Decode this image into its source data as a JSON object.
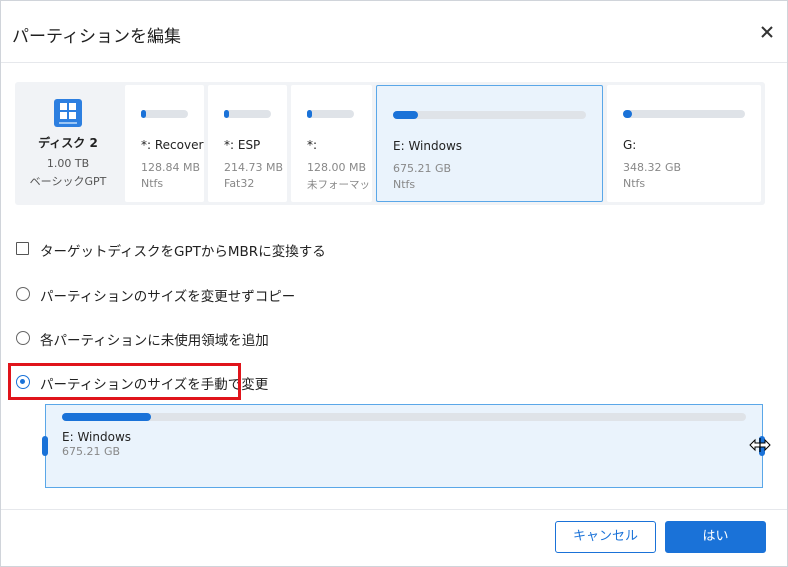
{
  "dialog": {
    "title": "パーティションを編集",
    "close_icon": "close-icon"
  },
  "disk": {
    "icon": "windows-disk-icon",
    "name": "ディスク 2",
    "size": "1.00 TB",
    "type": "ベーシックGPT"
  },
  "partitions": [
    {
      "label": "*: Recovery",
      "capacity": "128.84 MB",
      "fs": "Ntfs",
      "used_fraction": 0.1,
      "selected": false
    },
    {
      "label": "*: ESP",
      "capacity": "214.73 MB",
      "fs": "Fat32",
      "used_fraction": 0.1,
      "selected": false
    },
    {
      "label": "*:",
      "capacity": "128.00 MB",
      "fs": "未フォーマット",
      "used_fraction": 0.1,
      "selected": false
    },
    {
      "label": "E: Windows",
      "capacity": "675.21 GB",
      "fs": "Ntfs",
      "used_fraction": 0.13,
      "selected": true
    },
    {
      "label": "G:",
      "capacity": "348.32 GB",
      "fs": "Ntfs",
      "used_fraction": 0.07,
      "selected": false
    }
  ],
  "options": {
    "convert_mbr": {
      "label": "ターゲットディスクをGPTからMBRに変換する",
      "checked": false
    },
    "copy_no_resize": {
      "label": "パーティションのサイズを変更せずコピー",
      "selected": false
    },
    "add_unused": {
      "label": "各パーティションに未使用領域を追加",
      "selected": false
    },
    "manual_resize": {
      "label": "パーティションのサイズを手動で変更",
      "selected": true
    }
  },
  "resize": {
    "label": "E: Windows",
    "capacity": "675.21 GB",
    "used_fraction": 0.13
  },
  "footer": {
    "cancel_label": "キャンセル",
    "ok_label": "はい"
  },
  "colors": {
    "accent": "#1a72d8",
    "selected_bg": "#eaf3fc",
    "highlight": "#e0141b"
  }
}
